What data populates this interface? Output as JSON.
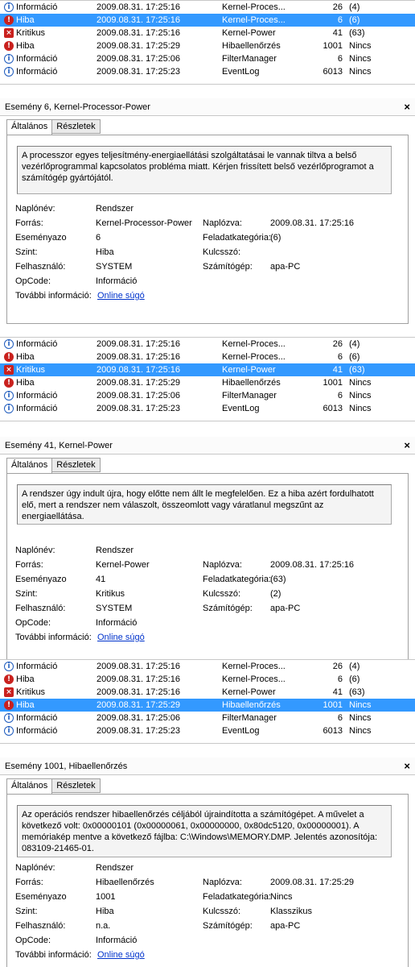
{
  "blocks": [
    {
      "list": [
        {
          "level": "Információ",
          "icon": "info",
          "date": "2009.08.31. 17:25:16",
          "source": "Kernel-Proces...",
          "id": "26",
          "cat": "(4)",
          "selected": false
        },
        {
          "level": "Hiba",
          "icon": "error",
          "date": "2009.08.31. 17:25:16",
          "source": "Kernel-Proces...",
          "id": "6",
          "cat": "(6)",
          "selected": true
        },
        {
          "level": "Kritikus",
          "icon": "critical",
          "date": "2009.08.31. 17:25:16",
          "source": "Kernel-Power",
          "id": "41",
          "cat": "(63)",
          "selected": false
        },
        {
          "level": "Hiba",
          "icon": "error",
          "date": "2009.08.31. 17:25:29",
          "source": "Hibaellenőrzés",
          "id": "1001",
          "cat": "Nincs",
          "selected": false
        },
        {
          "level": "Információ",
          "icon": "info",
          "date": "2009.08.31. 17:25:06",
          "source": "FilterManager",
          "id": "6",
          "cat": "Nincs",
          "selected": false
        },
        {
          "level": "Információ",
          "icon": "info",
          "date": "2009.08.31. 17:25:23",
          "source": "EventLog",
          "id": "6013",
          "cat": "Nincs",
          "selected": false
        }
      ],
      "detail": {
        "title": "Esemény 6, Kernel-Processor-Power",
        "tab_general": "Általános",
        "tab_details": "Részletek",
        "description": "A processzor egyes teljesítmény-energiaellátási szolgáltatásai le vannak tiltva a belső vezérlőprogrammal kapcsolatos probléma miatt. Kérjen frissített belső vezérlőprogramot a számítógép gyártójától.",
        "log_name_label": "Naplónév:",
        "log_name": "Rendszer",
        "source_label": "Forrás:",
        "source": "Kernel-Processor-Power",
        "logged_label": "Naplózva:",
        "logged": "2009.08.31. 17:25:16",
        "event_id_label": "Eseményazo",
        "event_id": "6",
        "task_label": "Feladatkategória:",
        "task": "(6)",
        "level_label": "Szint:",
        "level": "Hiba",
        "keywords_label": "Kulcsszó:",
        "keywords": "",
        "user_label": "Felhasználó:",
        "user": "SYSTEM",
        "computer_label": "Számítógép:",
        "computer": "apa-PC",
        "opcode_label": "OpCode:",
        "opcode": "Információ",
        "more_info_label": "További információ:",
        "more_info_link": "Online súgó"
      }
    },
    {
      "list": [
        {
          "level": "Információ",
          "icon": "info",
          "date": "2009.08.31. 17:25:16",
          "source": "Kernel-Proces...",
          "id": "26",
          "cat": "(4)",
          "selected": false
        },
        {
          "level": "Hiba",
          "icon": "error",
          "date": "2009.08.31. 17:25:16",
          "source": "Kernel-Proces...",
          "id": "6",
          "cat": "(6)",
          "selected": false
        },
        {
          "level": "Kritikus",
          "icon": "critical",
          "date": "2009.08.31. 17:25:16",
          "source": "Kernel-Power",
          "id": "41",
          "cat": "(63)",
          "selected": true
        },
        {
          "level": "Hiba",
          "icon": "error",
          "date": "2009.08.31. 17:25:29",
          "source": "Hibaellenőrzés",
          "id": "1001",
          "cat": "Nincs",
          "selected": false
        },
        {
          "level": "Információ",
          "icon": "info",
          "date": "2009.08.31. 17:25:06",
          "source": "FilterManager",
          "id": "6",
          "cat": "Nincs",
          "selected": false
        },
        {
          "level": "Információ",
          "icon": "info",
          "date": "2009.08.31. 17:25:23",
          "source": "EventLog",
          "id": "6013",
          "cat": "Nincs",
          "selected": false
        }
      ],
      "detail": {
        "title": "Esemény 41, Kernel-Power",
        "tab_general": "Általános",
        "tab_details": "Részletek",
        "description": "A rendszer úgy indult újra, hogy előtte nem állt le megfelelően. Ez a hiba azért fordulhatott elő, mert a rendszer nem válaszolt, összeomlott vagy váratlanul megszűnt az energiaellátása.",
        "log_name_label": "Naplónév:",
        "log_name": "Rendszer",
        "source_label": "Forrás:",
        "source": "Kernel-Power",
        "logged_label": "Naplózva:",
        "logged": "2009.08.31. 17:25:16",
        "event_id_label": "Eseményazo",
        "event_id": "41",
        "task_label": "Feladatkategória:",
        "task": "(63)",
        "level_label": "Szint:",
        "level": "Kritikus",
        "keywords_label": "Kulcsszó:",
        "keywords": "(2)",
        "user_label": "Felhasználó:",
        "user": "SYSTEM",
        "computer_label": "Számítógép:",
        "computer": "apa-PC",
        "opcode_label": "OpCode:",
        "opcode": "Információ",
        "more_info_label": "További információ:",
        "more_info_link": "Online súgó"
      }
    },
    {
      "list": [
        {
          "level": "Információ",
          "icon": "info",
          "date": "2009.08.31. 17:25:16",
          "source": "Kernel-Proces...",
          "id": "26",
          "cat": "(4)",
          "selected": false
        },
        {
          "level": "Hiba",
          "icon": "error",
          "date": "2009.08.31. 17:25:16",
          "source": "Kernel-Proces...",
          "id": "6",
          "cat": "(6)",
          "selected": false
        },
        {
          "level": "Kritikus",
          "icon": "critical",
          "date": "2009.08.31. 17:25:16",
          "source": "Kernel-Power",
          "id": "41",
          "cat": "(63)",
          "selected": false
        },
        {
          "level": "Hiba",
          "icon": "error",
          "date": "2009.08.31. 17:25:29",
          "source": "Hibaellenőrzés",
          "id": "1001",
          "cat": "Nincs",
          "selected": true
        },
        {
          "level": "Információ",
          "icon": "info",
          "date": "2009.08.31. 17:25:06",
          "source": "FilterManager",
          "id": "6",
          "cat": "Nincs",
          "selected": false
        },
        {
          "level": "Információ",
          "icon": "info",
          "date": "2009.08.31. 17:25:23",
          "source": "EventLog",
          "id": "6013",
          "cat": "Nincs",
          "selected": false
        }
      ],
      "detail": {
        "title": "Esemény 1001, Hibaellenőrzés",
        "tab_general": "Általános",
        "tab_details": "Részletek",
        "description": "Az operációs rendszer hibaellenőrzés céljából újraindította a számítógépet. A művelet a következő volt: 0x00000101 (0x00000061, 0x00000000, 0x80dc5120, 0x00000001). A memóriakép mentve a következő fájlba: C:\\Windows\\MEMORY.DMP. Jelentés azonosítója: 083109-21465-01.",
        "log_name_label": "Naplónév:",
        "log_name": "Rendszer",
        "source_label": "Forrás:",
        "source": "Hibaellenőrzés",
        "logged_label": "Naplózva:",
        "logged": "2009.08.31. 17:25:29",
        "event_id_label": "Eseményazo",
        "event_id": "1001",
        "task_label": "Feladatkategória:",
        "task": "Nincs",
        "level_label": "Szint:",
        "level": "Hiba",
        "keywords_label": "Kulcsszó:",
        "keywords": "Klasszikus",
        "user_label": "Felhasználó:",
        "user": "n.a.",
        "computer_label": "Számítógép:",
        "computer": "apa-PC",
        "opcode_label": "OpCode:",
        "opcode": "Információ",
        "more_info_label": "További információ:",
        "more_info_link": "Online súgó"
      }
    }
  ],
  "colors": {
    "selection": "#3399ff",
    "link": "#0033cc",
    "error_red": "#c9211e",
    "info_blue": "#1e5bbd"
  },
  "icons": {
    "info": "info-icon",
    "error": "error-icon",
    "critical": "critical-icon",
    "close": "close-icon"
  }
}
